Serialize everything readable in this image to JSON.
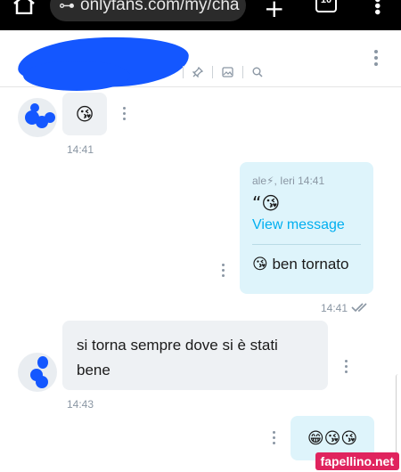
{
  "browser": {
    "url": "onlyfans.com/my/cha",
    "tune_glyph": "⊶",
    "plus_glyph": "+",
    "tabs_count": "10"
  },
  "messages": [
    {
      "direction": "in",
      "emoji": "😘",
      "time": "14:41"
    },
    {
      "direction": "out",
      "reply_to": {
        "name": "ale⚡, Ieri 14:41",
        "quote": "“😘",
        "link": "View message"
      },
      "text": "😘 ben tornato",
      "time": "14:41",
      "status": "double-check-read"
    },
    {
      "direction": "in",
      "text": "si torna sempre dove si è stati bene",
      "time": "14:43"
    },
    {
      "direction": "out",
      "emoji": "😁😘😘"
    }
  ],
  "watermark": "fapellino.net",
  "icons": {
    "header": [
      "pin-icon",
      "image-icon",
      "search-icon"
    ],
    "kebab": "kebab-menu-icon"
  },
  "colors": {
    "accent": "#00aff0",
    "out_bubble": "#def4fb",
    "in_bubble": "#eef1f4",
    "redaction": "#1457ff"
  }
}
